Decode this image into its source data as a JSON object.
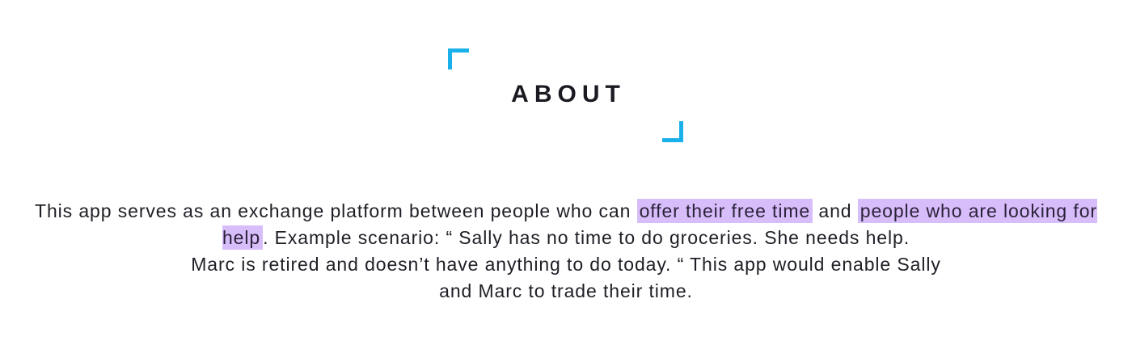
{
  "about": {
    "title": "ABOUT",
    "text_part1": "This app serves as an exchange platform between people who can ",
    "highlight1": "offer their free time",
    "text_part2": " and ",
    "highlight2": "people who are looking for help",
    "text_part3": ". Example scenario: “ Sally has no time to do groceries. She needs help.",
    "text_line3": "Marc is retired and doesn’t have anything to do today. “  This app would enable Sally",
    "text_line4": "and Marc to trade their time."
  },
  "colors": {
    "accent": "#1ab0ea",
    "highlight": "#d8bdfb",
    "text": "#1e1e26"
  }
}
